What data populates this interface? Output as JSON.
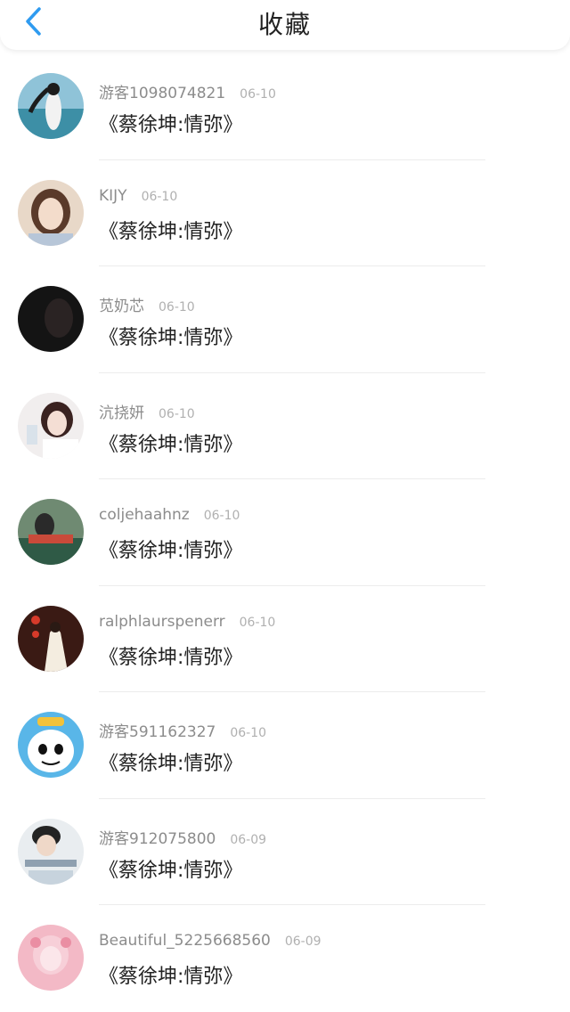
{
  "header": {
    "title": "收藏",
    "back_icon": "chevron-left-icon",
    "accent": "#2f9bf0"
  },
  "items": [
    {
      "username": "游客1098074821",
      "date": "06-10",
      "song": "《蔡徐坤:情弥》"
    },
    {
      "username": "KIJY",
      "date": "06-10",
      "song": "《蔡徐坤:情弥》"
    },
    {
      "username": "苋奶芯",
      "date": "06-10",
      "song": "《蔡徐坤:情弥》"
    },
    {
      "username": "沆挠妍",
      "date": "06-10",
      "song": "《蔡徐坤:情弥》"
    },
    {
      "username": "coljehaahnz",
      "date": "06-10",
      "song": "《蔡徐坤:情弥》"
    },
    {
      "username": "ralphlaurspenerr",
      "date": "06-10",
      "song": "《蔡徐坤:情弥》"
    },
    {
      "username": "游客591162327",
      "date": "06-10",
      "song": "《蔡徐坤:情弥》"
    },
    {
      "username": "游客912075800",
      "date": "06-09",
      "song": "《蔡徐坤:情弥》"
    },
    {
      "username": "Beautiful_5225668560",
      "date": "06-09",
      "song": "《蔡徐坤:情弥》"
    }
  ]
}
